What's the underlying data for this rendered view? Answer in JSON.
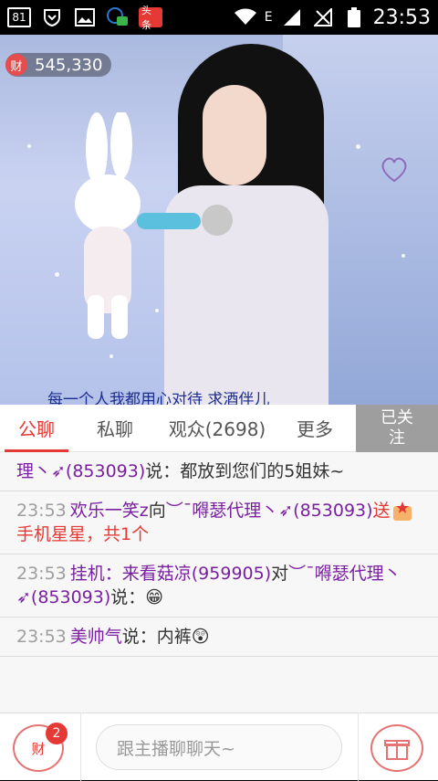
{
  "status_bar": {
    "notification_count": "81",
    "news_label": "头条",
    "network": "E",
    "time": "23:53"
  },
  "stream": {
    "coin_icon": "财",
    "coin_value": "545,330",
    "caption": "每一个人我都用心对待   求酒伴儿"
  },
  "tabs": [
    {
      "label": "公聊",
      "active": true
    },
    {
      "label": "私聊",
      "active": false
    },
    {
      "label": "观众(2698)",
      "active": false
    },
    {
      "label": "更多",
      "active": false
    }
  ],
  "follow_label_line1": "已关",
  "follow_label_line2": "注",
  "messages": [
    {
      "time": "",
      "parts": [
        {
          "t": "理丶➶(853093)",
          "c": "n"
        },
        {
          "t": "说：都放到您们的5姐妹~",
          "c": ""
        }
      ]
    },
    {
      "time": "23:53",
      "parts": [
        {
          "t": "欢乐一笑z",
          "c": "n"
        },
        {
          "t": "向",
          "c": ""
        },
        {
          "t": "︶ˉ嘚瑟代理丶➶(853093)",
          "c": "n"
        },
        {
          "t": "送",
          "c": "r"
        },
        {
          "t": "gift",
          "c": "gift"
        },
        {
          "t": "手机星星，共1个",
          "c": "r"
        }
      ]
    },
    {
      "time": "23:53",
      "parts": [
        {
          "t": "挂机：来看菇凉(959905)",
          "c": "n"
        },
        {
          "t": "对",
          "c": ""
        },
        {
          "t": "︶ˉ嘚瑟代理丶➶(853093)",
          "c": "n"
        },
        {
          "t": "说：😁",
          "c": ""
        }
      ]
    },
    {
      "time": "23:53",
      "parts": [
        {
          "t": "美帅气",
          "c": "n"
        },
        {
          "t": "说：内裤😲",
          "c": ""
        }
      ]
    }
  ],
  "bottom": {
    "wallet_label": "财",
    "wallet_badge": "2",
    "input_placeholder": "跟主播聊聊天~"
  }
}
